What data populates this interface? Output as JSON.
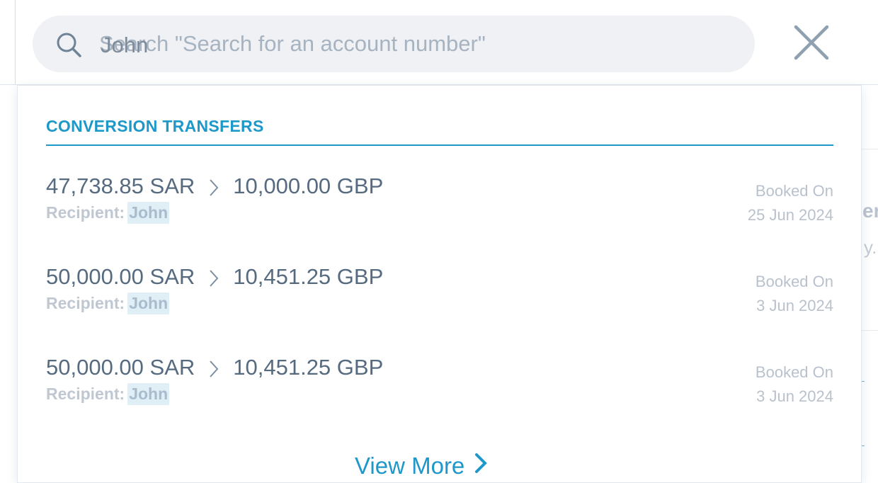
{
  "search": {
    "placeholder": "Search \"Search for an account number\"",
    "value": "John"
  },
  "section": {
    "title": "CONVERSION TRANSFERS"
  },
  "results": [
    {
      "from_amount": "47,738.85 SAR",
      "to_amount": "10,000.00 GBP",
      "recipient_label": "Recipient:",
      "recipient": "John",
      "booked_label": "Booked On",
      "booked_date": "25 Jun 2024"
    },
    {
      "from_amount": "50,000.00 SAR",
      "to_amount": "10,451.25 GBP",
      "recipient_label": "Recipient:",
      "recipient": "John",
      "booked_label": "Booked On",
      "booked_date": "3 Jun 2024"
    },
    {
      "from_amount": "50,000.00 SAR",
      "to_amount": "10,451.25 GBP",
      "recipient_label": "Recipient:",
      "recipient": "John",
      "booked_label": "Booked On",
      "booked_date": "3 Jun 2024"
    }
  ],
  "view_more": {
    "label": "View More"
  },
  "background": {
    "frag1": "er",
    "frag2": "y."
  },
  "colors": {
    "accent": "#1e98c9",
    "text": "#566a80",
    "muted": "#bfc8d2",
    "search_bg": "#eff1f4"
  },
  "icons": {
    "search": "search-icon",
    "close": "close-icon",
    "chevron": "chevron-right-icon"
  }
}
